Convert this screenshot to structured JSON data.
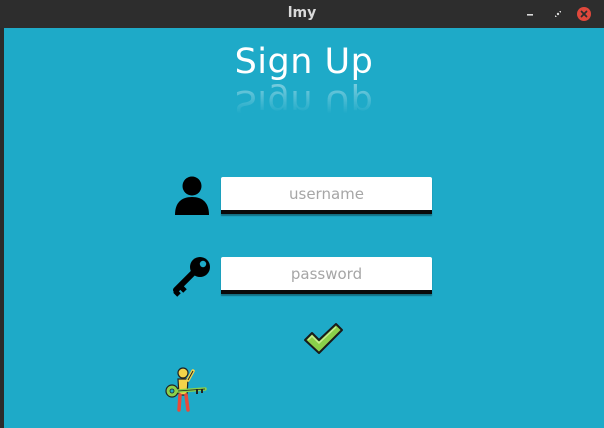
{
  "window": {
    "title": "lmy"
  },
  "form": {
    "heading": "Sign Up",
    "username_placeholder": "username",
    "password_placeholder": "password"
  },
  "icons": {
    "user": "user-icon",
    "key": "key-icon",
    "submit": "checkmark-icon",
    "logo": "person-with-key-icon"
  },
  "colors": {
    "background": "#1eaac8",
    "titlebar": "#2d2d2d",
    "close": "#e0483c",
    "check": "#8ad04a"
  }
}
